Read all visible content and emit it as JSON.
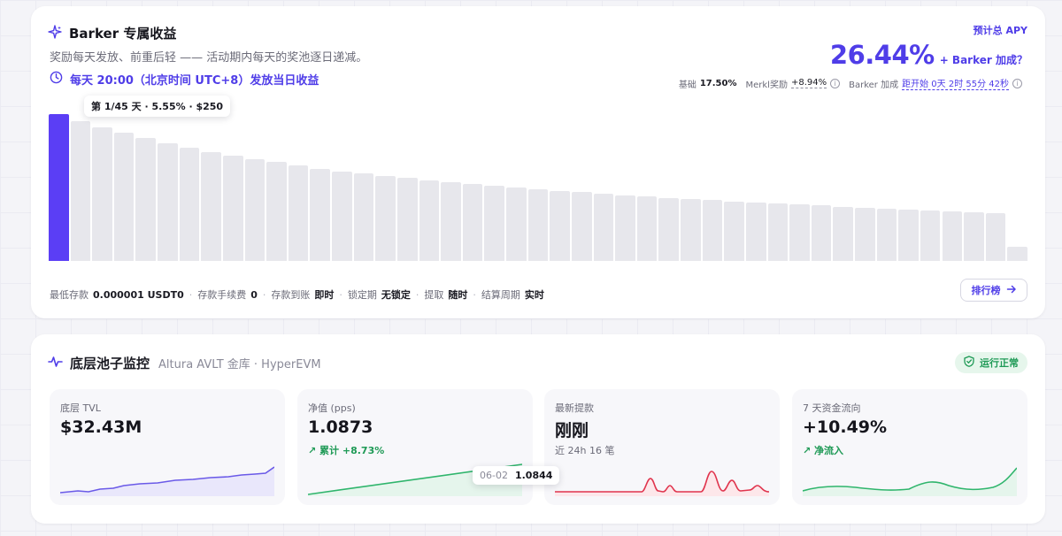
{
  "rewards": {
    "title": "Barker 专属收益",
    "subtitle": "奖励每天发放、前重后轻 —— 活动期内每天的奖池逐日递减。",
    "payout_text": "每天 20:00（北京时间 UTC+8）发放当日收益",
    "apy_label": "预计总 APY",
    "apy_value": "26.44%",
    "apy_boost": "+ Barker 加成？",
    "breakdown": {
      "base_label": "基础",
      "base_value": "17.50%",
      "merkl_label": "Merkl奖励",
      "merkl_value": "+8.94%",
      "barker_label": "Barker 加成",
      "countdown": "距开始 0天 2时 55分 42秒"
    },
    "tooltip": "第 1/45 天 · 5.55% · $250",
    "daily_pool_levels": [
      1.0,
      0.953,
      0.907,
      0.871,
      0.835,
      0.802,
      0.77,
      0.743,
      0.716,
      0.694,
      0.672,
      0.651,
      0.629,
      0.611,
      0.595,
      0.578,
      0.564,
      0.549,
      0.535,
      0.523,
      0.51,
      0.499,
      0.487,
      0.477,
      0.467,
      0.457,
      0.447,
      0.439,
      0.43,
      0.422,
      0.414,
      0.405,
      0.398,
      0.391,
      0.384,
      0.377,
      0.37,
      0.363,
      0.356,
      0.35,
      0.344,
      0.339,
      0.333,
      0.327,
      0.1
    ],
    "meta": [
      {
        "label": "最低存款",
        "value": "0.000001 USDT0"
      },
      {
        "label": "存款手续费",
        "value": "0"
      },
      {
        "label": "存款到账",
        "value": "即时"
      },
      {
        "label": "锁定期",
        "value": "无锁定"
      },
      {
        "label": "提取",
        "value": "随时"
      },
      {
        "label": "结算周期",
        "value": "实时"
      }
    ],
    "rank_button": "排行榜"
  },
  "pool": {
    "title": "底层池子监控",
    "subtitle": "Altura AVLT 金库 · HyperEVM",
    "status": "运行正常",
    "stats": [
      {
        "label": "底层 TVL",
        "value": "$32.43M",
        "change": ""
      },
      {
        "label": "净值 (pps)",
        "value": "1.0873",
        "change": "累计 +8.73%"
      },
      {
        "label": "最新提款",
        "value": "刚刚",
        "change": "近 24h 16 笔"
      },
      {
        "label": "7 天资金流向",
        "value": "+10.49%",
        "change": "净流入"
      }
    ],
    "pps_tooltip": {
      "date": "06-02",
      "value": "1.0844"
    }
  },
  "colors": {
    "accent": "#4f3de8",
    "bar_active": "#5b3ef5",
    "bar_inactive": "#e7e7ec",
    "positive": "#1f9a56",
    "negative": "#e0344d"
  }
}
